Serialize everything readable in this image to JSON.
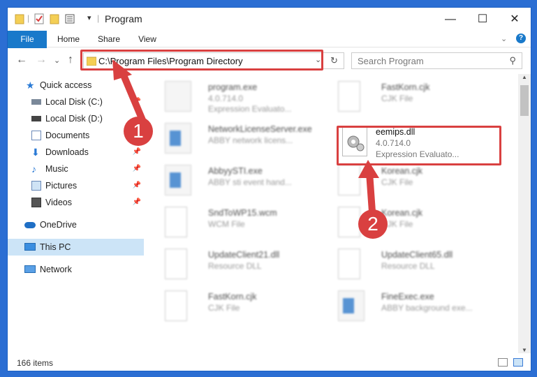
{
  "window": {
    "title": "Program"
  },
  "ribbon": {
    "tabs": [
      "File",
      "Home",
      "Share",
      "View"
    ]
  },
  "address": {
    "path": "C:\\Program Files\\Program Directory"
  },
  "search": {
    "placeholder": "Search Program"
  },
  "sidebar": {
    "items": [
      {
        "label": "Quick access",
        "icon": "star-icon"
      },
      {
        "label": "Local Disk (C:)",
        "icon": "drive-icon"
      },
      {
        "label": "Local Disk (D:)",
        "icon": "drive-icon"
      },
      {
        "label": "Documents",
        "icon": "documents-icon"
      },
      {
        "label": "Downloads",
        "icon": "download-icon"
      },
      {
        "label": "Music",
        "icon": "music-icon"
      },
      {
        "label": "Pictures",
        "icon": "pictures-icon"
      },
      {
        "label": "Videos",
        "icon": "videos-icon"
      },
      {
        "label": "OneDrive",
        "icon": "cloud-icon"
      },
      {
        "label": "This PC",
        "icon": "computer-icon"
      },
      {
        "label": "Network",
        "icon": "network-icon"
      }
    ]
  },
  "files": [
    {
      "name": "program.exe",
      "line2": "4.0.714.0",
      "line3": "Expression Evaluato..."
    },
    {
      "name": "FastKorn.cjk",
      "line2": "CJK File",
      "line3": ""
    },
    {
      "name": "NetworkLicenseServer.exe",
      "line2": "ABBY network licens...",
      "line3": ""
    },
    {
      "name": "eemips.dll",
      "line2": "4.0.714.0",
      "line3": "Expression Evaluato..."
    },
    {
      "name": "AbbyySTI.exe",
      "line2": "ABBY sti event hand...",
      "line3": ""
    },
    {
      "name": "Korean.cjk",
      "line2": "CJK File",
      "line3": ""
    },
    {
      "name": "SndToWP15.wcm",
      "line2": "WCM File",
      "line3": ""
    },
    {
      "name": "Korean.cjk",
      "line2": "CJK File",
      "line3": ""
    },
    {
      "name": "UpdateClient21.dll",
      "line2": "Resource DLL",
      "line3": ""
    },
    {
      "name": "UpdateClient65.dll",
      "line2": "Resource DLL",
      "line3": ""
    },
    {
      "name": "FastKorn.cjk",
      "line2": "CJK File",
      "line3": ""
    },
    {
      "name": "FineExec.exe",
      "line2": "ABBY background exe...",
      "line3": ""
    }
  ],
  "status": {
    "items": "166 items"
  },
  "annotations": {
    "step1": "1",
    "step2": "2"
  },
  "colors": {
    "accent": "#1979ca",
    "highlight": "#d94040",
    "selection": "#cce4f7"
  }
}
